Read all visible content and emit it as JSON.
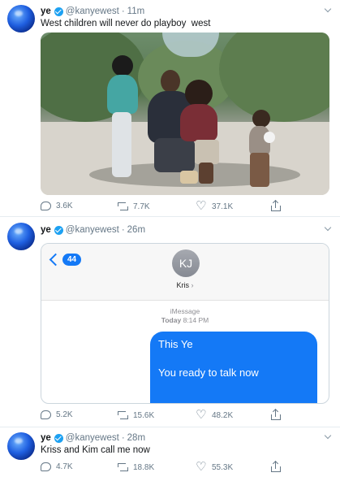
{
  "tweets": [
    {
      "name": "ye",
      "handle": "@kanyewest",
      "dot": "·",
      "time": "11m",
      "text": "West children will never do playboy  west",
      "stats": {
        "replies": "3.6K",
        "retweets": "7.7K",
        "likes": "37.1K"
      }
    },
    {
      "name": "ye",
      "handle": "@kanyewest",
      "dot": "·",
      "time": "26m",
      "text": "",
      "stats": {
        "replies": "5.2K",
        "retweets": "15.6K",
        "likes": "48.2K"
      },
      "imessage": {
        "back_count": "44",
        "initials": "KJ",
        "contact": "Kris",
        "contact_chevron": "›",
        "service": "iMessage",
        "day": "Today",
        "clock": "8:14 PM",
        "bubble_line1": "This Ye",
        "bubble_line2": "You ready to talk now"
      }
    },
    {
      "name": "ye",
      "handle": "@kanyewest",
      "dot": "·",
      "time": "28m",
      "text": "Kriss and Kim call me now",
      "stats": {
        "replies": "4.7K",
        "retweets": "18.8K",
        "likes": "55.3K"
      }
    }
  ],
  "colors": {
    "twitter_blue": "#1da1f2",
    "imessage_blue": "#1479f6",
    "muted_text": "#657786"
  },
  "icons": [
    "verified-badge-icon",
    "reply-icon",
    "retweet-icon",
    "like-icon",
    "share-icon",
    "caret-down-icon",
    "back-chevron-icon"
  ]
}
